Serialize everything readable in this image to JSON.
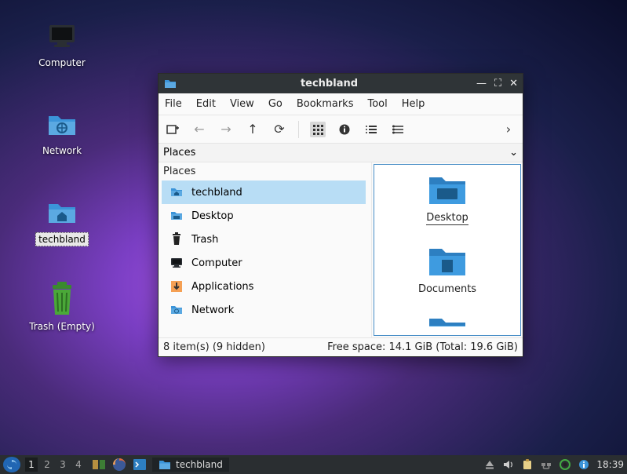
{
  "desktop_icons": [
    {
      "name": "computer",
      "label": "Computer"
    },
    {
      "name": "network",
      "label": "Network"
    },
    {
      "name": "home",
      "label": "techbland",
      "selected": true
    },
    {
      "name": "trash",
      "label": "Trash (Empty)"
    }
  ],
  "window": {
    "title": "techbland",
    "menubar": [
      "File",
      "Edit",
      "View",
      "Go",
      "Bookmarks",
      "Tool",
      "Help"
    ],
    "places_header": "Places",
    "sidebar": {
      "section": "Places",
      "items": [
        {
          "icon": "home",
          "label": "techbland",
          "active": true
        },
        {
          "icon": "desktop",
          "label": "Desktop"
        },
        {
          "icon": "trash",
          "label": "Trash"
        },
        {
          "icon": "computer",
          "label": "Computer"
        },
        {
          "icon": "applications",
          "label": "Applications"
        },
        {
          "icon": "network",
          "label": "Network"
        }
      ]
    },
    "folders": [
      {
        "label": "Desktop",
        "icon": "desktop"
      },
      {
        "label": "Documents",
        "icon": "documents"
      },
      {
        "label": "",
        "icon": "folder-partial"
      }
    ],
    "status_left": "8 item(s) (9 hidden)",
    "status_right": "Free space: 14.1 GiB (Total: 19.6 GiB)"
  },
  "taskbar": {
    "workspaces": [
      "1",
      "2",
      "3",
      "4"
    ],
    "active_workspace": 0,
    "task_label": "techbland",
    "clock": "18:39"
  }
}
